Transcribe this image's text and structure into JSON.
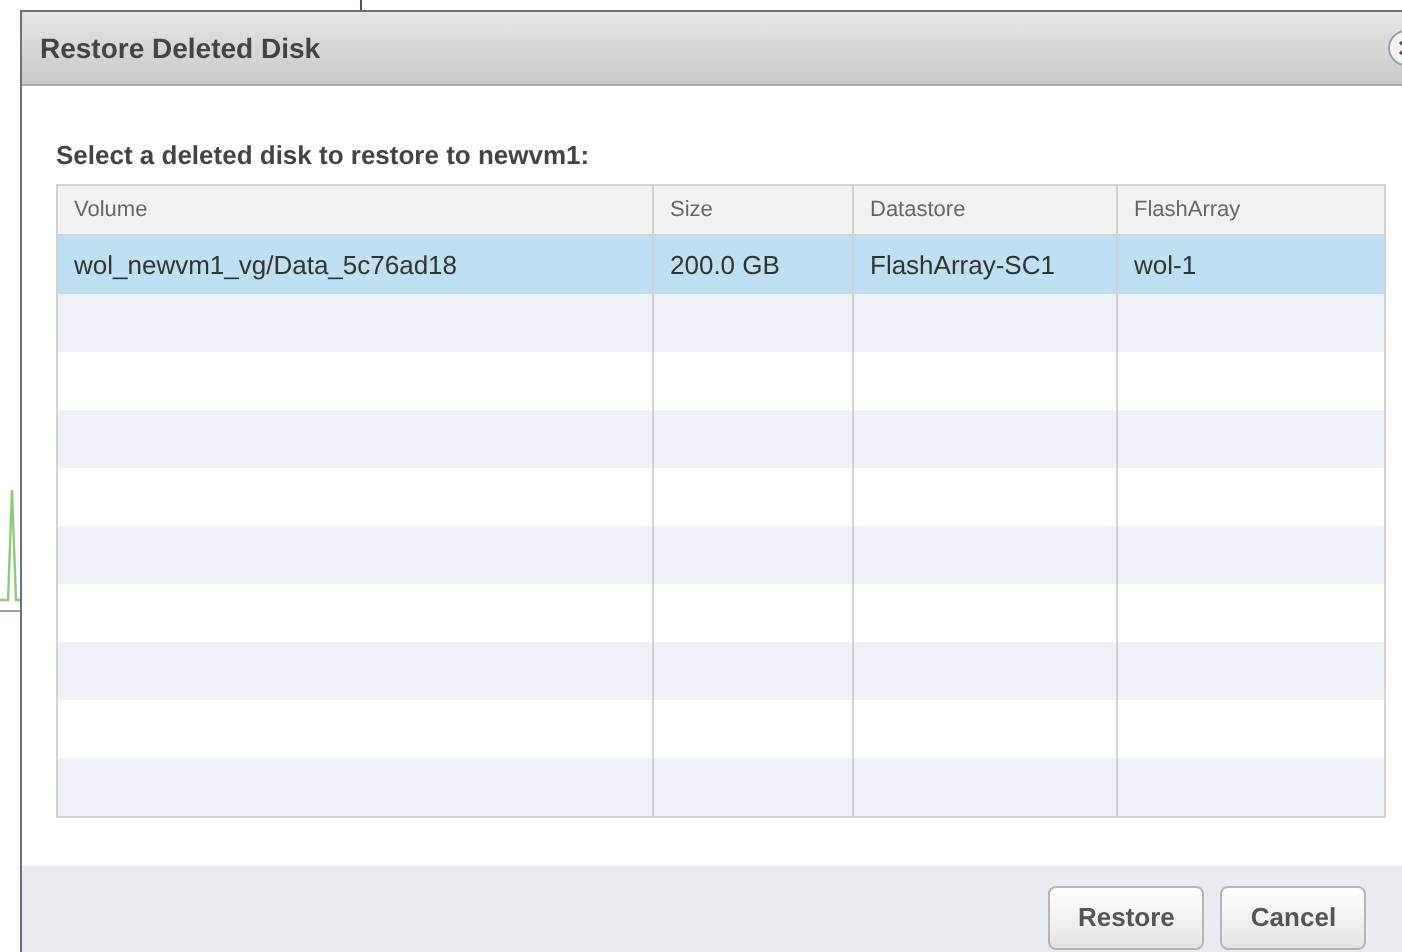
{
  "dialog": {
    "title": "Restore Deleted Disk",
    "prompt": "Select a deleted disk to restore to newvm1:"
  },
  "table": {
    "columns": [
      "Volume",
      "Size",
      "Datastore",
      "FlashArray"
    ],
    "rows": [
      {
        "cells": [
          "wol_newvm1_vg/Data_5c76ad18",
          "200.0 GB",
          "FlashArray-SC1",
          "wol-1"
        ],
        "selected": true
      }
    ]
  },
  "buttons": [
    "Restore",
    "Cancel"
  ]
}
